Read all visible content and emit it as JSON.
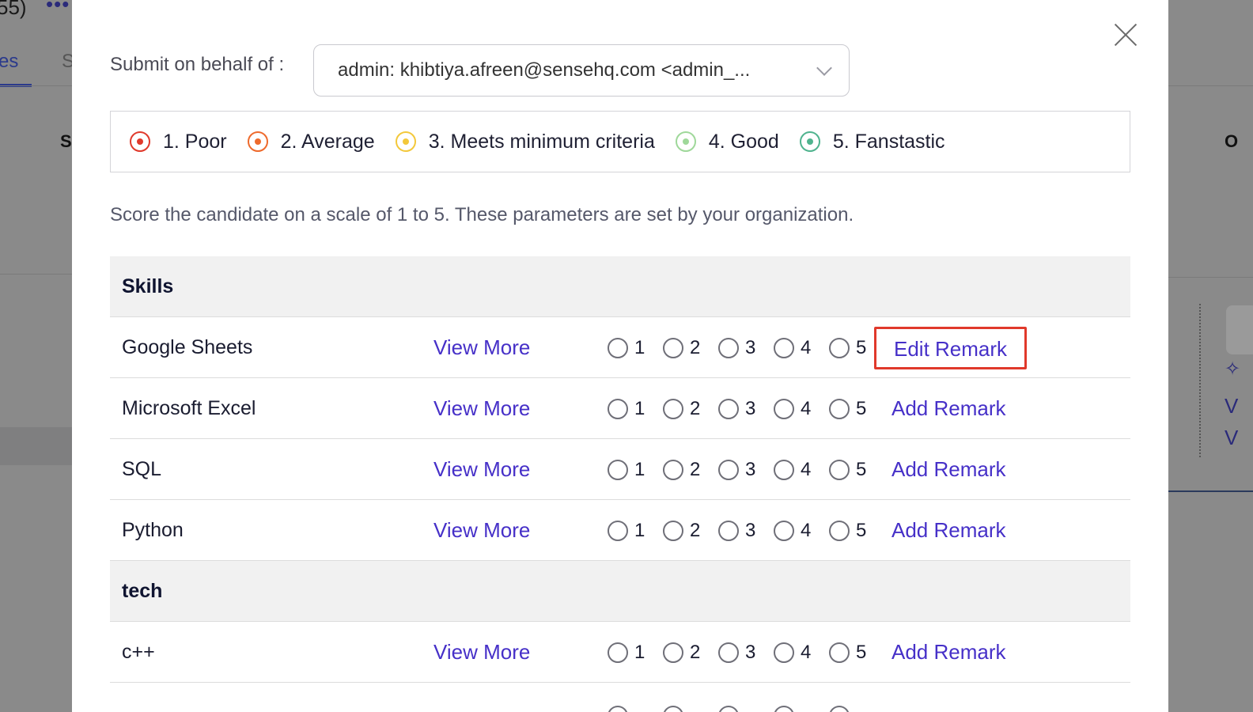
{
  "background": {
    "title_fragment": "55)",
    "dots": "•••",
    "tab_active": "es",
    "tab_other": "S",
    "left_heading": "S",
    "right_heading": "O",
    "right_star": "✧",
    "right_v1": "V",
    "right_v2": "V"
  },
  "modal": {
    "submit_label": "Submit on behalf of :",
    "submit_value": "admin: khibtiya.afreen@sensehq.com <admin_...",
    "legend": [
      {
        "label": "1. Poor",
        "color": "#e0392b"
      },
      {
        "label": "2. Average",
        "color": "#ee6a2c"
      },
      {
        "label": "3. Meets minimum criteria",
        "color": "#f3c83b"
      },
      {
        "label": "4. Good",
        "color": "#9fd89a"
      },
      {
        "label": "5. Fanstastic",
        "color": "#4fb38e"
      }
    ],
    "hint": "Score the candidate on a scale of 1 to 5. These parameters are set by your organization.",
    "scores": [
      "1",
      "2",
      "3",
      "4",
      "5"
    ],
    "view_more": "View More",
    "sections": [
      {
        "title": "Skills",
        "rows": [
          {
            "name": "Google Sheets",
            "remark": "Edit Remark"
          },
          {
            "name": "Microsoft Excel",
            "remark": "Add Remark"
          },
          {
            "name": "SQL",
            "remark": "Add Remark"
          },
          {
            "name": "Python",
            "remark": "Add Remark"
          }
        ]
      },
      {
        "title": "tech",
        "rows": [
          {
            "name": "c++",
            "remark": "Add Remark"
          }
        ]
      }
    ]
  }
}
